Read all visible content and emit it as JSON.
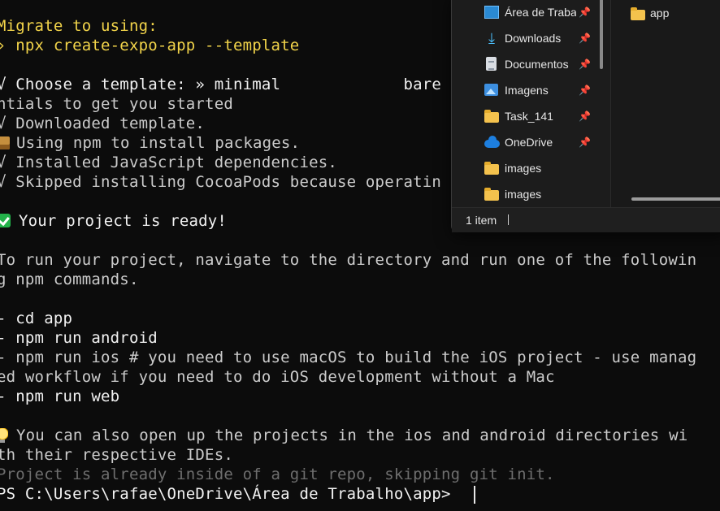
{
  "terminal": {
    "lines": [
      "Migrate to using:",
      "› npx create-expo-app --template",
      "",
      "√ Choose a template: » minimal             bare",
      "ntials to get you started",
      "√ Downloaded template.",
      "Using npm to install packages.",
      "√ Installed JavaScript dependencies.",
      "√ Skipped installing CocoaPods because operatin",
      "",
      "Your project is ready!",
      "",
      "To run your project, navigate to the directory and run one of the followin",
      "g npm commands.",
      "",
      "- cd app",
      "- npm run android",
      "- npm run ios # you need to use macOS to build the iOS project - use manag",
      "ed workflow if you need to do iOS development without a Mac",
      "- npm run web",
      "",
      "You can also open up the projects in the ios and android directories wi",
      "th their respective IDEs.",
      "Project is already inside of a git repo, skipping git init.",
      "PS C:\\Users\\rafae\\OneDrive\\Área de Trabalho\\app>"
    ]
  },
  "explorer": {
    "nav_items": [
      {
        "label": "Área de Trabalho",
        "icon": "desktop-icon",
        "pinned": true
      },
      {
        "label": "Downloads",
        "icon": "download-icon",
        "pinned": true
      },
      {
        "label": "Documentos",
        "icon": "document-icon",
        "pinned": true
      },
      {
        "label": "Imagens",
        "icon": "pictures-icon",
        "pinned": true
      },
      {
        "label": "Task_141",
        "icon": "folder-icon",
        "pinned": true
      },
      {
        "label": "OneDrive",
        "icon": "onedrive-icon",
        "pinned": true
      },
      {
        "label": "images",
        "icon": "folder-icon",
        "pinned": false
      },
      {
        "label": "images",
        "icon": "folder-icon",
        "pinned": false
      }
    ],
    "content_items": [
      {
        "label": "app",
        "icon": "folder-icon"
      }
    ],
    "status": {
      "item_count": "1 item"
    }
  },
  "colors": {
    "terminal_bg": "#0c0c0c",
    "prompt_yellow": "#f2d44a",
    "success_green": "#16c60c",
    "dim_text": "#6e6e6e",
    "explorer_bg": "#1c1c1c"
  }
}
